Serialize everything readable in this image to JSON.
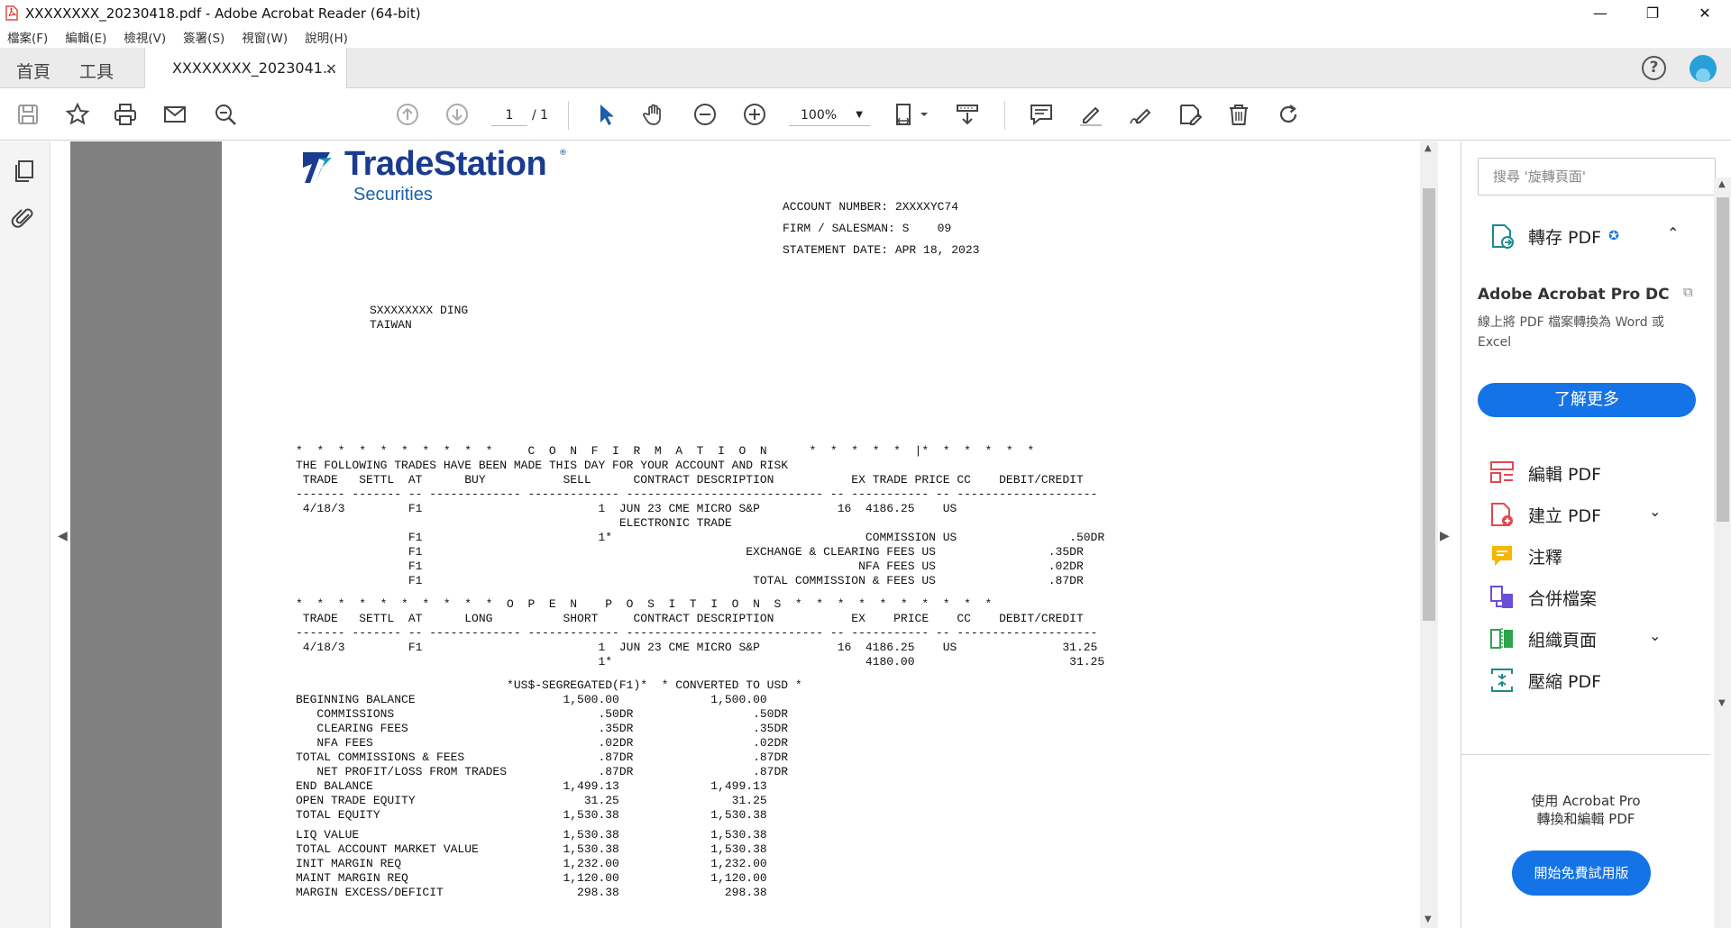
{
  "window": {
    "title": "XXXXXXXX_20230418.pdf - Adobe Acrobat Reader (64-bit)",
    "minimize": "—",
    "maximize": "❐",
    "close": "✕"
  },
  "menu": [
    "檔案(F)",
    "編輯(E)",
    "檢視(V)",
    "簽署(S)",
    "視窗(W)",
    "說明(H)"
  ],
  "tabs": {
    "home": "首頁",
    "tools": "工具",
    "document": "XXXXXXXX_2023041...",
    "close": "×"
  },
  "header": {
    "help": "?"
  },
  "toolbar": {
    "page_current": "1",
    "page_total": "/ 1",
    "zoom": "100%",
    "zoom_dropdown": "▼"
  },
  "doc": {
    "brand": "TradeStation",
    "brand_sub": "Securities",
    "brand_reg": "®",
    "header_lines": "ACCOUNT NUMBER: 2XXXXYC74\nFIRM / SALESMAN: S    09\nSTATEMENT DATE: APR 18, 2023",
    "address": "SXXXXXXXX DING\nTAIWAN",
    "confirmation": "*  *  *  *  *  *  *  *  *  *     C  O  N  F  I  R  M  A  T  I  O  N      *  *  *  *  *  |*  *  *  *  *  *\nTHE FOLLOWING TRADES HAVE BEEN MADE THIS DAY FOR YOUR ACCOUNT AND RISK\n TRADE   SETTL  AT      BUY           SELL      CONTRACT DESCRIPTION           EX TRADE PRICE CC    DEBIT/CREDIT\n------- ------- -- ------------- ------------- ---------------------------- -- ----------- -- --------------------\n 4/18/3         F1                         1  JUN 23 CME MICRO S&P           16  4186.25    US\n                                              ELECTRONIC TRADE\n                F1                         1*                                    COMMISSION US                .50DR\n                F1                                              EXCHANGE & CLEARING FEES US                .35DR\n                F1                                                              NFA FEES US                .02DR\n                F1                                               TOTAL COMMISSION & FEES US                .87DR",
    "open_positions": "*  *  *  *  *  *  *  *  *  *  O  P  E  N    P  O  S  I  T  I  O  N  S  *  *  *  *  *  *  *  *  *  *\n TRADE   SETTL  AT      LONG          SHORT     CONTRACT DESCRIPTION           EX    PRICE    CC    DEBIT/CREDIT\n------- ------- -- ------------- ------------- ---------------------------- -- ----------- -- --------------------\n 4/18/3         F1                         1  JUN 23 CME MICRO S&P           16  4186.25    US               31.25\n                                           1*                                    4180.00                      31.25",
    "balances": "                              *US$-SEGREGATED(F1)*  * CONVERTED TO USD *\nBEGINNING BALANCE                     1,500.00             1,500.00\n   COMMISSIONS                             .50DR                 .50DR\n   CLEARING FEES                           .35DR                 .35DR\n   NFA FEES                                .02DR                 .02DR\nTOTAL COMMISSIONS & FEES                   .87DR                 .87DR\n   NET PROFIT/LOSS FROM TRADES             .87DR                 .87DR\nEND BALANCE                           1,499.13             1,499.13\nOPEN TRADE EQUITY                        31.25                31.25\nTOTAL EQUITY                          1,530.38             1,530.38",
    "margins": "LIQ VALUE                             1,530.38             1,530.38\nTOTAL ACCOUNT MARKET VALUE            1,530.38             1,530.38\nINIT MARGIN REQ                       1,232.00             1,232.00\nMAINT MARGIN REQ                      1,120.00             1,120.00\nMARGIN EXCESS/DEFICIT                   298.38               298.38"
  },
  "rightpanel": {
    "search_placeholder": "搜尋 '旋轉頁面'",
    "export_pdf": "轉存 PDF",
    "promo_title": "Adobe Acrobat Pro DC",
    "promo_text": "線上將 PDF 檔案轉換為 Word 或 Excel",
    "learn_more": "了解更多",
    "tools": [
      {
        "label": "編輯 PDF",
        "icon": "edit-pdf-icon"
      },
      {
        "label": "建立 PDF",
        "icon": "create-pdf-icon"
      },
      {
        "label": "注釋",
        "icon": "comment-icon"
      },
      {
        "label": "合併檔案",
        "icon": "combine-files-icon"
      },
      {
        "label": "組織頁面",
        "icon": "organize-pages-icon"
      },
      {
        "label": "壓縮 PDF",
        "icon": "compress-pdf-icon"
      }
    ],
    "bottom_promo_line1": "使用 Acrobat Pro",
    "bottom_promo_line2": "轉換和編輯 PDF",
    "trial_button": "開始免費試用版"
  },
  "colors": {
    "accent": "#1473e6",
    "brand_navy": "#1a3b8f",
    "brand_teal": "#1c9ab7"
  }
}
